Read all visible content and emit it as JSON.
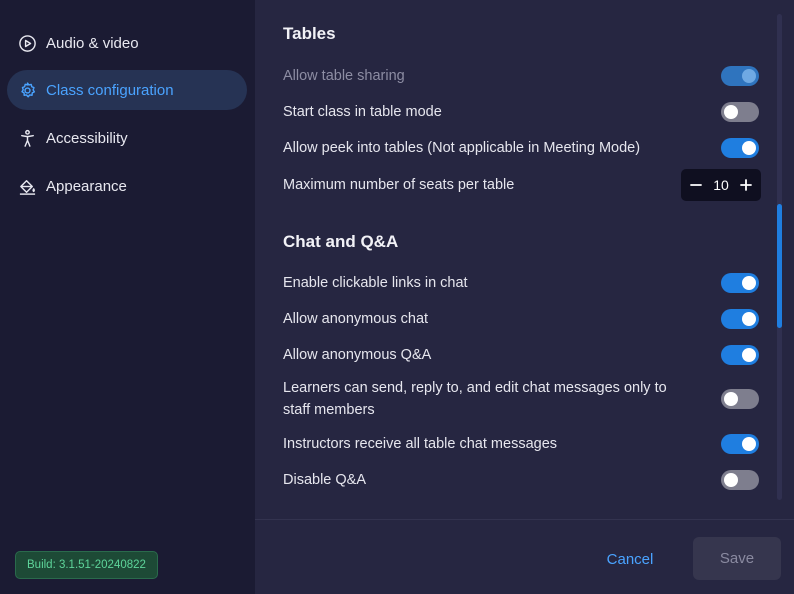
{
  "sidebar": {
    "items": [
      {
        "label": "Audio & video",
        "icon": "play-circle-icon"
      },
      {
        "label": "Class configuration",
        "icon": "gear-icon",
        "active": true
      },
      {
        "label": "Accessibility",
        "icon": "accessibility-person-icon"
      },
      {
        "label": "Appearance",
        "icon": "paint-bucket-icon"
      }
    ],
    "build": "Build: 3.1.51-20240822"
  },
  "sections": {
    "tables": {
      "title": "Tables",
      "allow_table_sharing": {
        "label": "Allow table sharing",
        "value": true,
        "disabled": true
      },
      "start_class_table_mode": {
        "label": "Start class in table mode",
        "value": false
      },
      "allow_peek": {
        "label": "Allow peek into tables (Not applicable in Meeting Mode)",
        "value": true
      },
      "max_seats": {
        "label": "Maximum number of seats per table",
        "value": "10"
      }
    },
    "chat": {
      "title": "Chat and Q&A",
      "clickable_links": {
        "label": "Enable clickable links in chat",
        "value": true
      },
      "anonymous_chat": {
        "label": "Allow anonymous chat",
        "value": true
      },
      "anonymous_qa": {
        "label": "Allow anonymous Q&A",
        "value": true
      },
      "learners_staff_only": {
        "label": "Learners can send, reply to, and edit chat messages only to staff members",
        "value": false
      },
      "instructors_receive": {
        "label": "Instructors receive all table chat messages",
        "value": true
      },
      "disable_qa": {
        "label": "Disable Q&A",
        "value": false
      }
    }
  },
  "footer": {
    "cancel_label": "Cancel",
    "save_label": "Save"
  },
  "colors": {
    "accent": "#1f7ee0",
    "link": "#4aa3ff",
    "build_text": "#5ed49a"
  }
}
